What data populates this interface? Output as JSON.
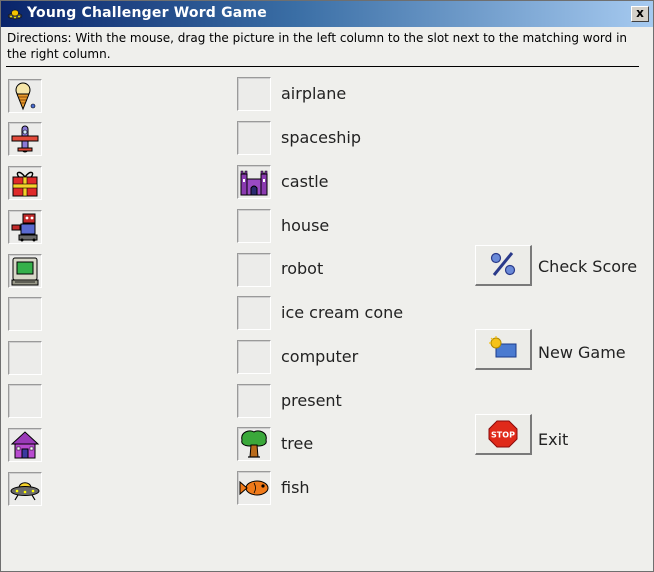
{
  "window": {
    "title": "Young Challenger Word Game",
    "close_glyph": "x"
  },
  "directions": "Directions: With the mouse, drag the picture in the left column to the slot next to the matching word in the right column.",
  "left_column": [
    {
      "icon": "ice-cream-cone-icon"
    },
    {
      "icon": "airplane-icon"
    },
    {
      "icon": "present-icon"
    },
    {
      "icon": "robot-icon"
    },
    {
      "icon": "computer-icon"
    },
    {
      "icon": null
    },
    {
      "icon": null
    },
    {
      "icon": null
    },
    {
      "icon": "house-icon"
    },
    {
      "icon": "spaceship-icon"
    }
  ],
  "words": [
    {
      "label": "airplane",
      "slot_icon": null
    },
    {
      "label": "spaceship",
      "slot_icon": null
    },
    {
      "label": "castle",
      "slot_icon": "castle-icon"
    },
    {
      "label": "house",
      "slot_icon": null
    },
    {
      "label": "robot",
      "slot_icon": null
    },
    {
      "label": "ice cream cone",
      "slot_icon": null
    },
    {
      "label": "computer",
      "slot_icon": null
    },
    {
      "label": "present",
      "slot_icon": null
    },
    {
      "label": "tree",
      "slot_icon": "tree-icon"
    },
    {
      "label": "fish",
      "slot_icon": "fish-icon"
    }
  ],
  "buttons": {
    "check_score": {
      "label": "Check Score",
      "icon": "percent-icon"
    },
    "new_game": {
      "label": "New Game",
      "icon": "new-game-icon"
    },
    "exit": {
      "label": "Exit",
      "icon": "stop-sign-icon"
    }
  },
  "colors": {
    "titlebar_start": "#0a246a",
    "titlebar_end": "#a6caf0",
    "window_bg": "#efefec"
  }
}
